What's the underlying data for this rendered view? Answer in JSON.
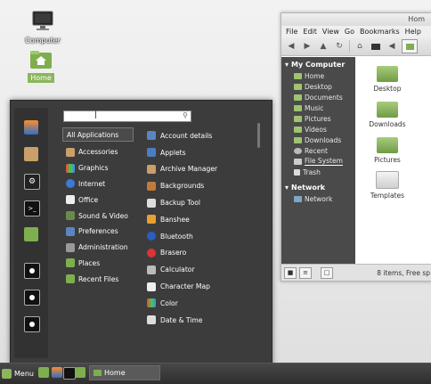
{
  "desktop": {
    "icons": [
      {
        "label": "Computer"
      },
      {
        "label": "Home"
      }
    ]
  },
  "file_manager": {
    "title": "Hom",
    "menubar": [
      "File",
      "Edit",
      "View",
      "Go",
      "Bookmarks",
      "Help"
    ],
    "sidebar": {
      "my_computer": "My Computer",
      "items": [
        "Home",
        "Desktop",
        "Documents",
        "Music",
        "Pictures",
        "Videos",
        "Downloads",
        "Recent",
        "File System",
        "Trash"
      ],
      "network_head": "Network",
      "network_items": [
        "Network"
      ]
    },
    "folders": [
      "Desktop",
      "Downloads",
      "Pictures",
      "Templates"
    ],
    "status_text": "8 items, Free sp"
  },
  "menu": {
    "search_placeholder": "",
    "categories": [
      "All Applications",
      "Accessories",
      "Graphics",
      "Internet",
      "Office",
      "Sound & Video",
      "Preferences",
      "Administration",
      "Places",
      "Recent Files"
    ],
    "apps": [
      "Account details",
      "Applets",
      "Archive Manager",
      "Backgrounds",
      "Backup Tool",
      "Banshee",
      "Bluetooth",
      "Brasero",
      "Calculator",
      "Character Map",
      "Color",
      "Date & Time"
    ]
  },
  "panel": {
    "menu_label": "Menu",
    "task_label": "Home"
  },
  "colors": {
    "accent_green": "#8cb55c",
    "menu_bg": "#3c3c3c",
    "sidebar_bg": "#4a4a4a"
  }
}
